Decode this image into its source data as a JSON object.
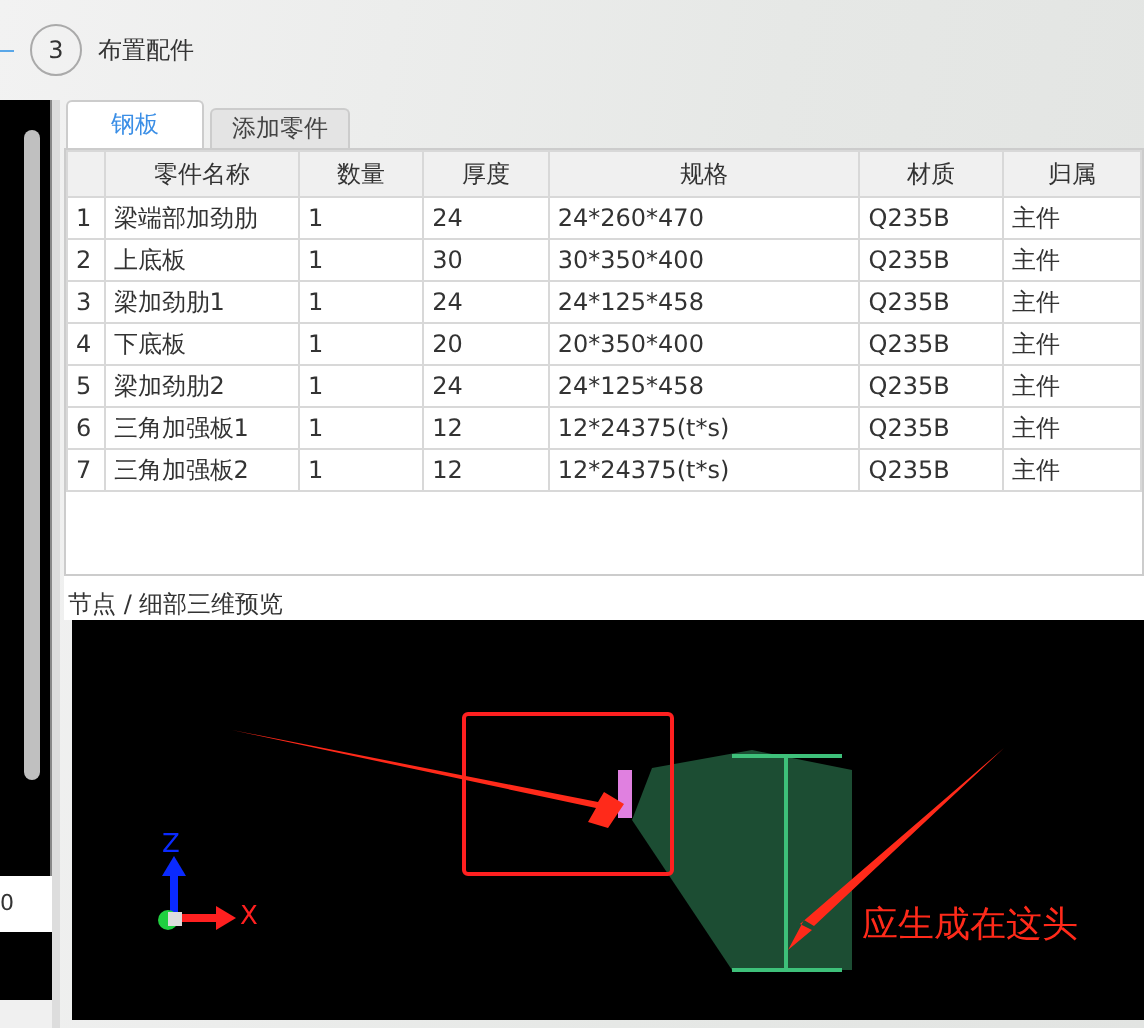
{
  "step": {
    "number": "3",
    "title": "布置配件"
  },
  "left_panel": {
    "value": "0"
  },
  "tabs": [
    {
      "label": "钢板",
      "selected": true
    },
    {
      "label": "添加零件",
      "selected": false
    }
  ],
  "table": {
    "columns": [
      "零件名称",
      "数量",
      "厚度",
      "规格",
      "材质",
      "归属"
    ],
    "rows": [
      {
        "index": "1",
        "cells": [
          "梁端部加劲肋",
          "1",
          "24",
          "24*260*470",
          "Q235B",
          "主件"
        ]
      },
      {
        "index": "2",
        "cells": [
          "上底板",
          "1",
          "30",
          "30*350*400",
          "Q235B",
          "主件"
        ]
      },
      {
        "index": "3",
        "cells": [
          "梁加劲肋1",
          "1",
          "24",
          "24*125*458",
          "Q235B",
          "主件"
        ]
      },
      {
        "index": "4",
        "cells": [
          "下底板",
          "1",
          "20",
          "20*350*400",
          "Q235B",
          "主件"
        ]
      },
      {
        "index": "5",
        "cells": [
          "梁加劲肋2",
          "1",
          "24",
          "24*125*458",
          "Q235B",
          "主件"
        ]
      },
      {
        "index": "6",
        "cells": [
          "三角加强板1",
          "1",
          "12",
          "12*24375(t*s)",
          "Q235B",
          "主件"
        ]
      },
      {
        "index": "7",
        "cells": [
          "三角加强板2",
          "1",
          "12",
          "12*24375(t*s)",
          "Q235B",
          "主件"
        ]
      }
    ]
  },
  "preview": {
    "title": "节点 / 细部三维预览",
    "axis_z": "Z",
    "axis_x": "X",
    "annotation": "应生成在这头"
  }
}
